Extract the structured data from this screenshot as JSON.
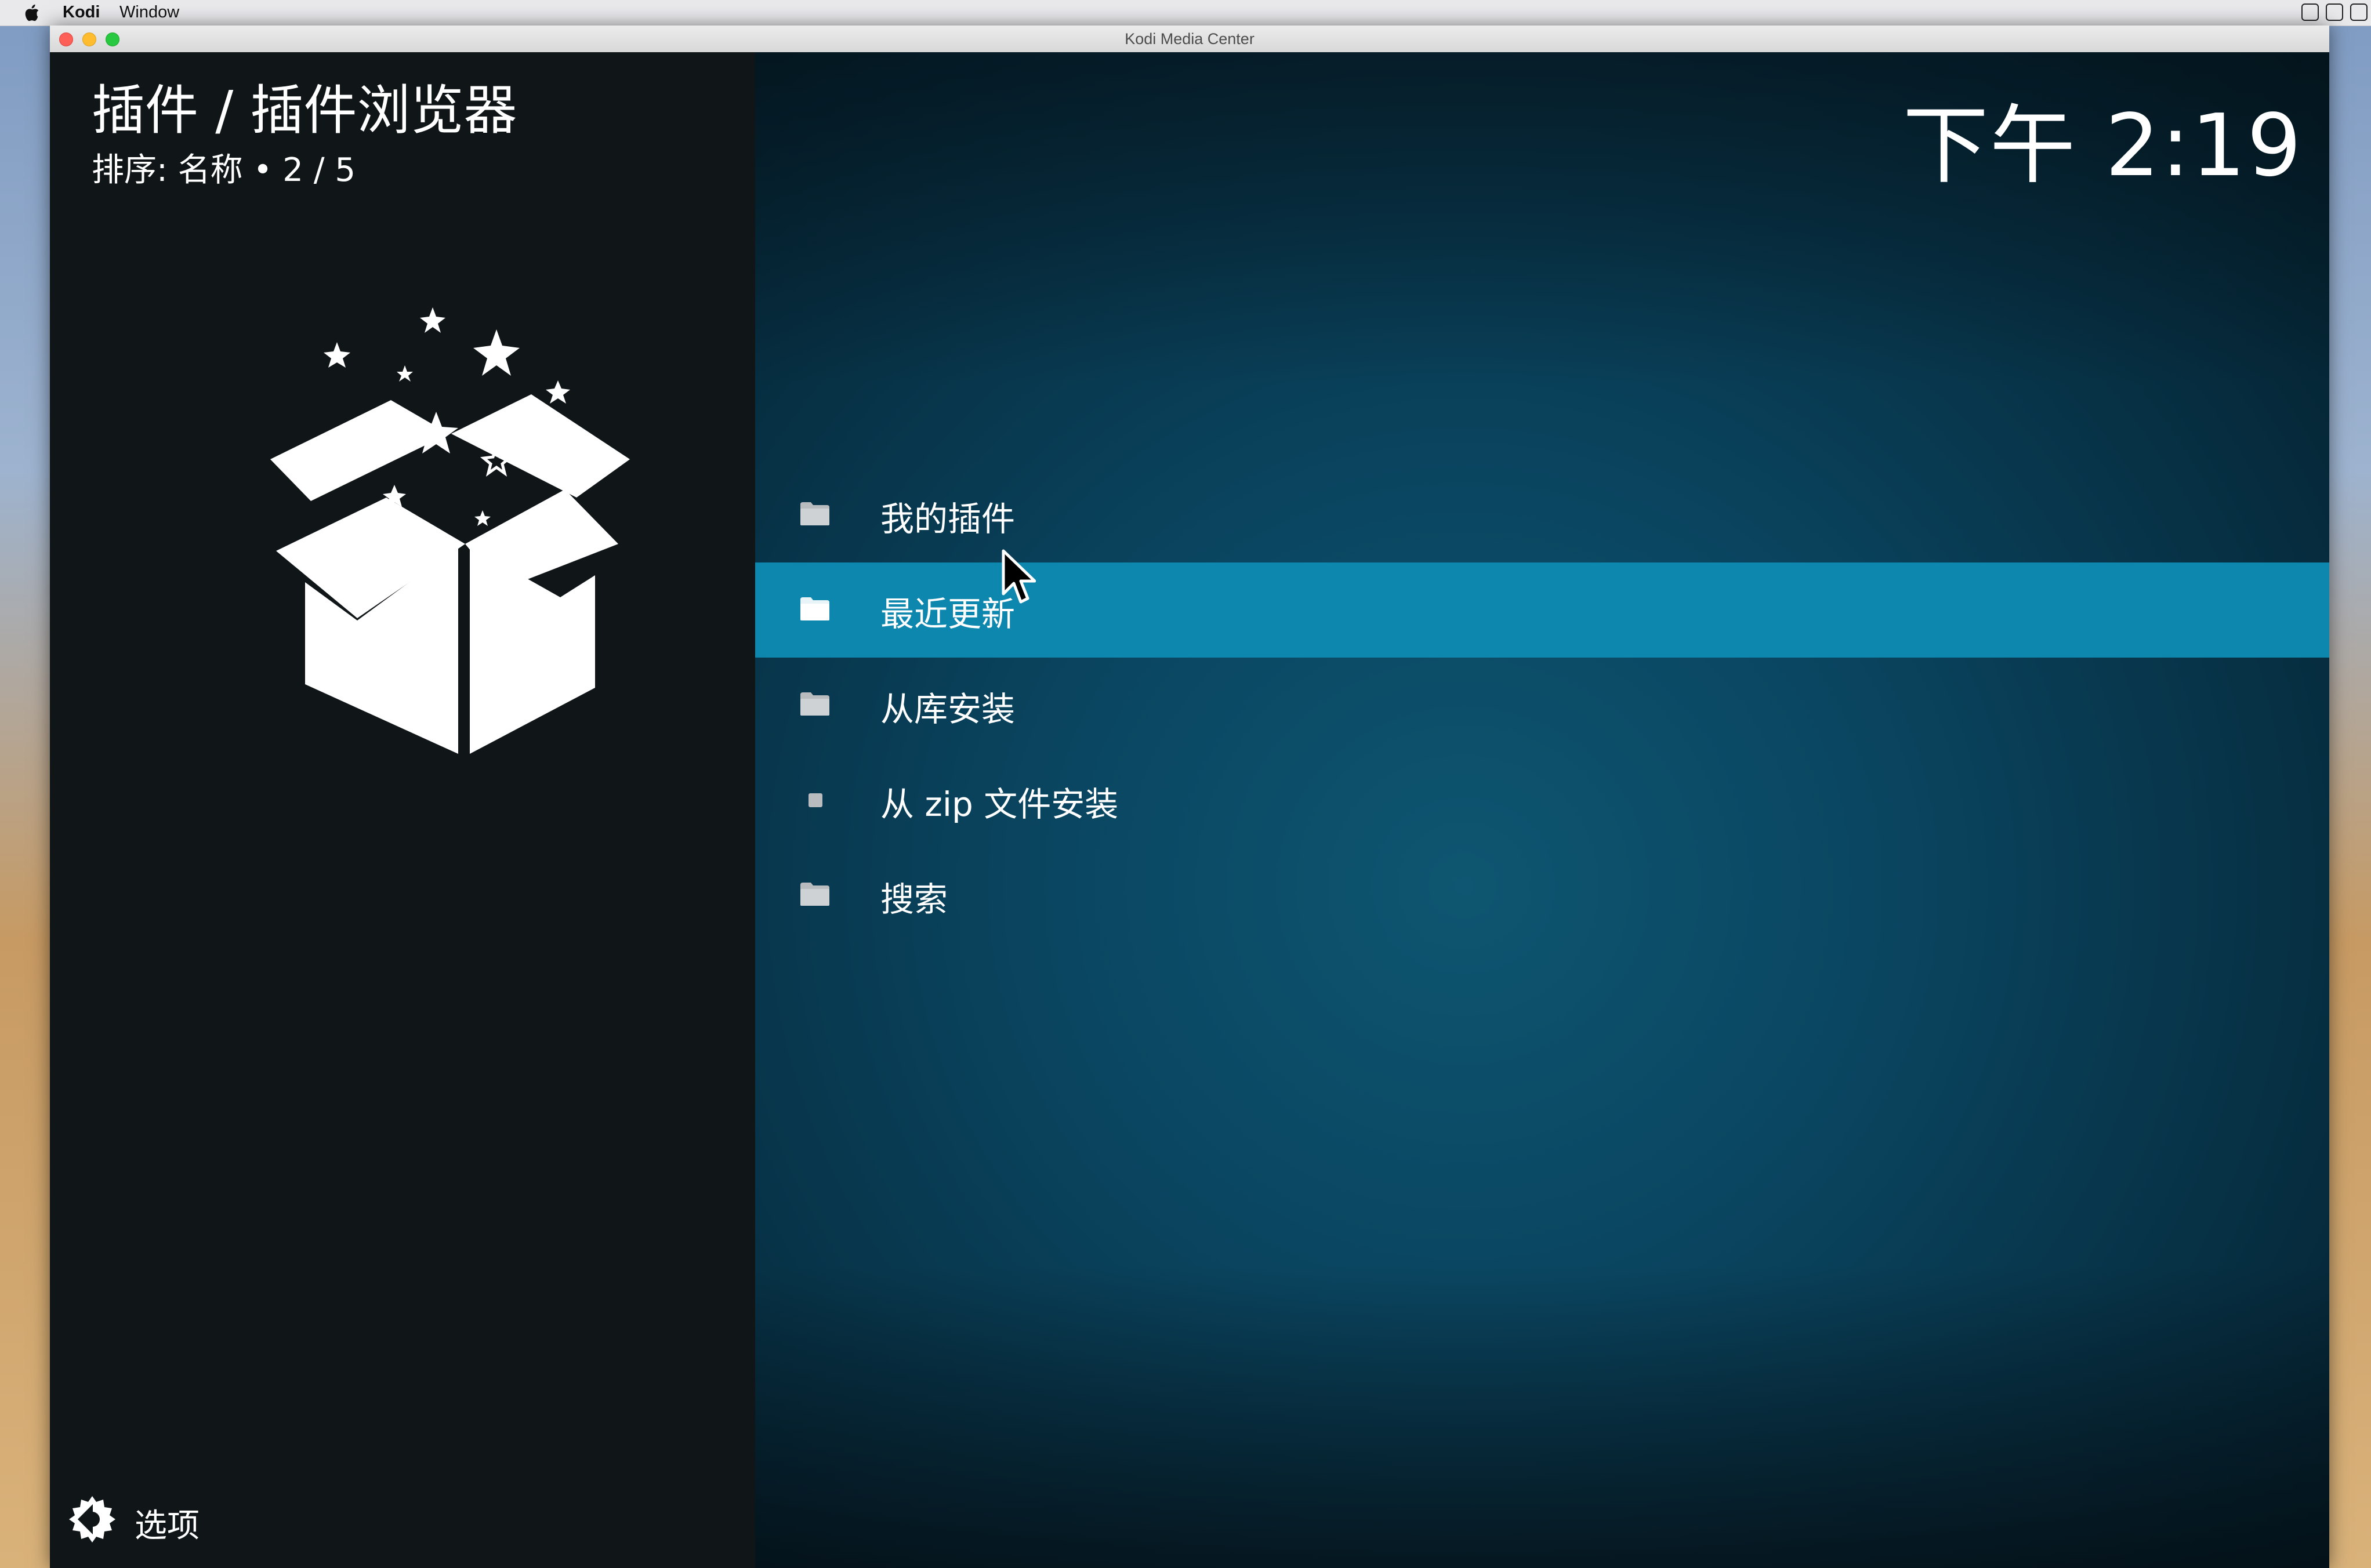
{
  "menubar": {
    "app_name": "Kodi",
    "menu_window": "Window",
    "apple_icon": "apple-icon"
  },
  "window": {
    "title": "Kodi Media Center"
  },
  "header": {
    "title": "插件 / 插件浏览器",
    "subtitle": "排序: 名称  •  2 / 5"
  },
  "clock": {
    "time": "下午 2:19"
  },
  "hero_icon": "addon-box-icon",
  "menu": {
    "items": [
      {
        "label": "我的插件",
        "icon": "folder-icon"
      },
      {
        "label": "最近更新",
        "icon": "folder-icon",
        "selected": true
      },
      {
        "label": "从库安装",
        "icon": "folder-icon"
      },
      {
        "label": "从 zip 文件安装",
        "icon": "zip-icon"
      },
      {
        "label": "搜索",
        "icon": "folder-icon"
      }
    ]
  },
  "footer": {
    "options_label": "选项",
    "options_icon": "settings-gear-icon"
  },
  "colors": {
    "selection": "#0e87ae",
    "left_panel": "#101518",
    "right_panel": "#0a4560"
  }
}
